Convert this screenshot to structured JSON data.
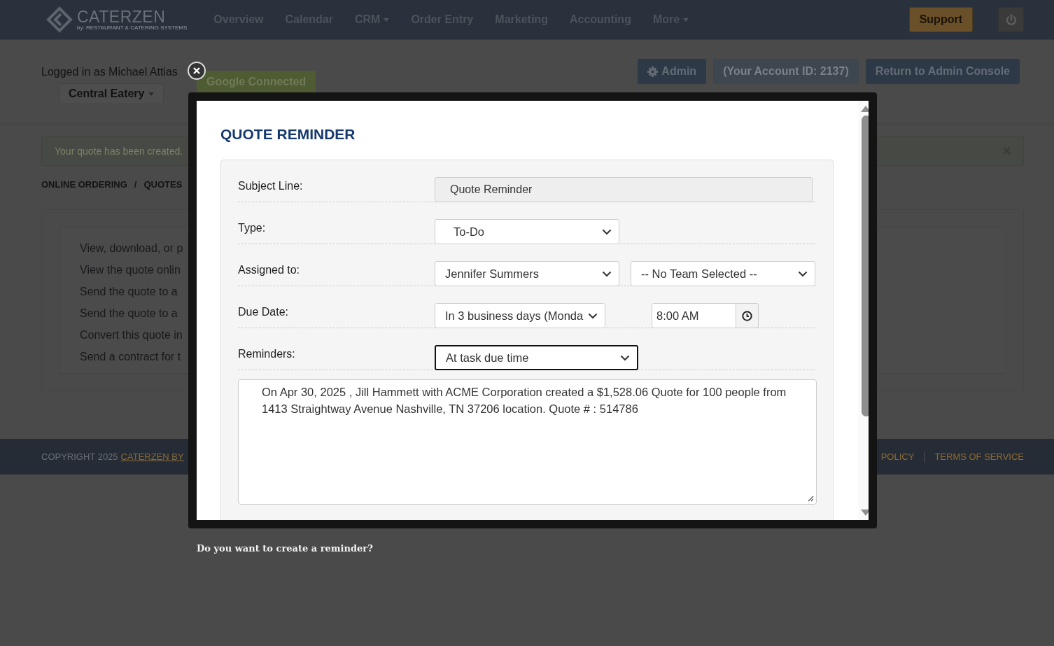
{
  "nav": {
    "logo": "CATERZEN",
    "tagline": "by: RESTAURANT & CATERING SYSTEMS",
    "items": [
      {
        "label": "Overview",
        "dropdown": false
      },
      {
        "label": "Calendar",
        "dropdown": false
      },
      {
        "label": "CRM",
        "dropdown": true
      },
      {
        "label": "Order Entry",
        "dropdown": false
      },
      {
        "label": "Marketing",
        "dropdown": false
      },
      {
        "label": "Accounting",
        "dropdown": false
      },
      {
        "label": "More",
        "dropdown": true
      }
    ],
    "support": "Support"
  },
  "header": {
    "logged_in": "Logged in as Michael Attias",
    "account": "Central Eatery",
    "google": "Google Connected",
    "buttons": [
      {
        "kind": "admin",
        "label": "Admin"
      },
      {
        "kind": "info",
        "label": "(Your Account ID: 2137)"
      },
      {
        "kind": "plain",
        "label": "Return to Admin Console"
      }
    ]
  },
  "alert": {
    "message": "Your quote has been created."
  },
  "breadcrumb": {
    "items": [
      "ONLINE ORDERING",
      "QUOTES"
    ],
    "separator": "/"
  },
  "actions": [
    "View, download, or p",
    "View the quote onlin",
    "Send the quote to a",
    "Send the quote to a",
    "Convert this quote in",
    "Send a contract for t"
  ],
  "footer": {
    "copyright": "COPYRIGHT 2025",
    "link": "CATERZEN BY",
    "links": [
      "POLICY",
      "TERMS OF SERVICE"
    ]
  },
  "modal": {
    "title": "QUOTE REMINDER",
    "fields": [
      {
        "kind": "text",
        "label": "Subject Line:",
        "value": "Quote Reminder",
        "readonly": true
      },
      {
        "kind": "select",
        "label": "Type:",
        "value": "To-Do"
      },
      {
        "kind": "select-pair",
        "label": "Assigned to:",
        "values": [
          "Jennifer Summers",
          "-- No Team Selected --"
        ]
      },
      {
        "kind": "due",
        "label": "Due Date:",
        "value": "In 3 business days (Monda",
        "time": "8:00 AM"
      },
      {
        "kind": "select-wide",
        "label": "Reminders:",
        "value": "At task due time",
        "focused": true
      }
    ],
    "message": "On Apr 30, 2025 , Jill Hammett with ACME Corporation created a $1,528.06 Quote for 100 people from 1413 Straightway Avenue Nashville, TN 37206 location. Quote # : 514786"
  },
  "prompt": "Do you want to create a reminder?"
}
